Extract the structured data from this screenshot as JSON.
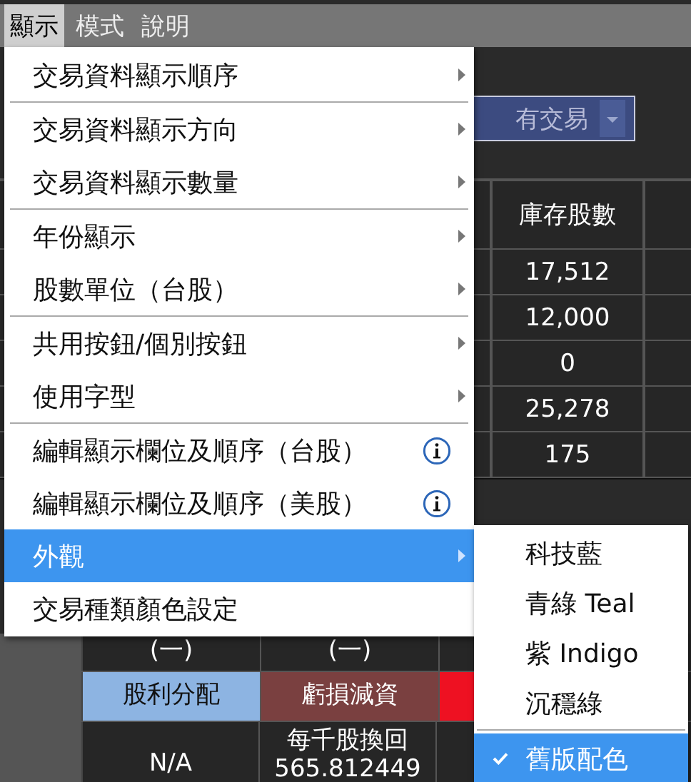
{
  "menubar": [
    {
      "label": "顯示",
      "selected": true
    },
    {
      "label": "模式",
      "selected": false
    },
    {
      "label": "說明",
      "selected": false
    }
  ],
  "filter": {
    "value": "有交易"
  },
  "table": {
    "header": "庫存股數",
    "rows": [
      "17,512",
      "12,000",
      "0",
      "25,278",
      "175"
    ]
  },
  "lower": {
    "signs": [
      "(一)",
      "(一)"
    ],
    "tags": [
      {
        "label": "股利分配",
        "color": "#8db4e2"
      },
      {
        "label": "虧損減資",
        "color": "#7a4040"
      },
      {
        "color": "#ee1122"
      }
    ],
    "values": [
      "N/A",
      "每千股換回\n565.812449"
    ]
  },
  "menu": [
    {
      "kind": "submenu",
      "label": "交易資料顯示順序",
      "selected": false
    },
    {
      "kind": "separator"
    },
    {
      "kind": "submenu",
      "label": "交易資料顯示方向",
      "selected": false
    },
    {
      "kind": "submenu",
      "label": "交易資料顯示數量",
      "selected": false
    },
    {
      "kind": "separator"
    },
    {
      "kind": "submenu",
      "label": "年份顯示",
      "selected": false
    },
    {
      "kind": "submenu",
      "label": "股數單位（台股）",
      "selected": false
    },
    {
      "kind": "separator"
    },
    {
      "kind": "submenu",
      "label": "共用按鈕/個別按鈕",
      "selected": false
    },
    {
      "kind": "submenu",
      "label": "使用字型",
      "selected": false
    },
    {
      "kind": "separator"
    },
    {
      "kind": "info",
      "label": "編輯顯示欄位及順序（台股）",
      "selected": false
    },
    {
      "kind": "info",
      "label": "編輯顯示欄位及順序（美股）",
      "selected": false
    },
    {
      "kind": "submenu",
      "label": "外觀",
      "selected": true
    },
    {
      "kind": "plain",
      "label": "交易種類顏色設定",
      "selected": false
    }
  ],
  "submenu": [
    {
      "kind": "item",
      "label": "科技藍",
      "checked": false,
      "selected": false
    },
    {
      "kind": "item",
      "label": "青綠 Teal",
      "checked": false,
      "selected": false
    },
    {
      "kind": "item",
      "label": "紫 Indigo",
      "checked": false,
      "selected": false
    },
    {
      "kind": "item",
      "label": "沉穩綠",
      "checked": false,
      "selected": false
    },
    {
      "kind": "separator"
    },
    {
      "kind": "item",
      "label": "舊版配色",
      "checked": true,
      "selected": true
    }
  ]
}
